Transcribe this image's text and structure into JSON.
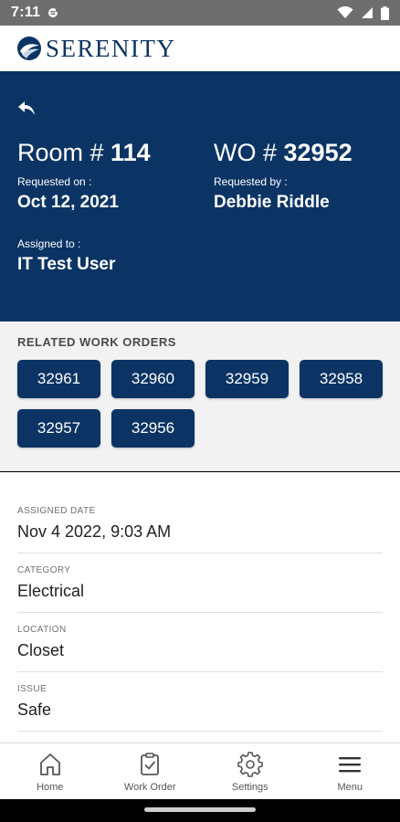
{
  "status_bar": {
    "time": "7:11",
    "icons": [
      "notification-icon",
      "wifi-icon",
      "signal-icon",
      "battery-icon"
    ]
  },
  "app_bar": {
    "logo_text": "SERENITY",
    "brand_color": "#0b3465"
  },
  "work_order": {
    "room_prefix": "Room # ",
    "room_number": "114",
    "wo_prefix": "WO # ",
    "wo_number": "32952",
    "requested_on_label": "Requested on :",
    "requested_on": "Oct 12, 2021",
    "requested_by_label": "Requested by :",
    "requested_by": "Debbie Riddle",
    "assigned_to_label": "Assigned to :",
    "assigned_to": "IT Test User"
  },
  "related": {
    "title": "RELATED WORK ORDERS",
    "orders": [
      "32961",
      "32960",
      "32959",
      "32958",
      "32957",
      "32956"
    ]
  },
  "details": [
    {
      "label": "ASSIGNED DATE",
      "value": "Nov 4 2022, 9:03 AM"
    },
    {
      "label": "CATEGORY",
      "value": "Electrical"
    },
    {
      "label": "LOCATION",
      "value": "Closet"
    },
    {
      "label": "ISSUE",
      "value": "Safe"
    }
  ],
  "bottom_nav": [
    {
      "label": "Home",
      "icon": "home-icon"
    },
    {
      "label": "Work Order",
      "icon": "clipboard-check-icon"
    },
    {
      "label": "Settings",
      "icon": "gear-icon"
    },
    {
      "label": "Menu",
      "icon": "menu-icon"
    }
  ]
}
